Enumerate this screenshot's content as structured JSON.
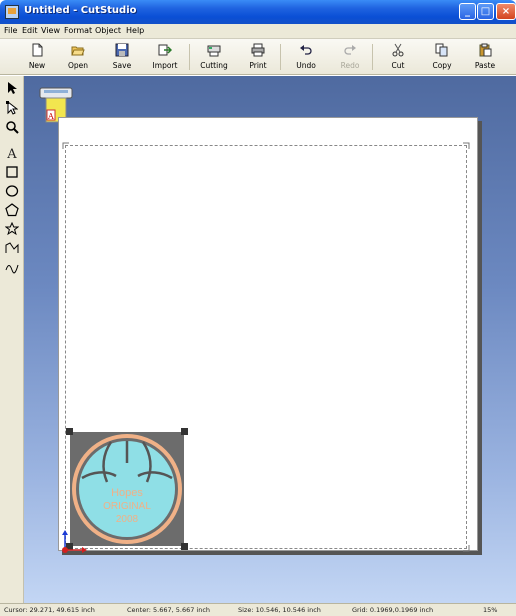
{
  "window": {
    "title": "Untitled - CutStudio"
  },
  "menu": [
    "File",
    "Edit",
    "View",
    "Format",
    "Object",
    "Help"
  ],
  "toolbar": [
    {
      "label": "New",
      "icon": "new-document-icon",
      "enabled": true
    },
    {
      "label": "Open",
      "icon": "open-folder-icon",
      "enabled": true
    },
    {
      "label": "Save",
      "icon": "save-disk-icon",
      "enabled": true
    },
    {
      "label": "Import",
      "icon": "import-icon",
      "enabled": true
    },
    {
      "label": "Cutting",
      "icon": "cutting-plotter-icon",
      "enabled": true
    },
    {
      "label": "Print",
      "icon": "printer-icon",
      "enabled": true
    },
    {
      "label": "Undo",
      "icon": "undo-icon",
      "enabled": true
    },
    {
      "label": "Redo",
      "icon": "redo-icon",
      "enabled": false
    },
    {
      "label": "Cut",
      "icon": "scissors-icon",
      "enabled": true
    },
    {
      "label": "Copy",
      "icon": "copy-icon",
      "enabled": true
    },
    {
      "label": "Paste",
      "icon": "paste-icon",
      "enabled": true
    }
  ],
  "tools": [
    "select-arrow-icon",
    "node-edit-icon",
    "zoom-icon",
    "text-tool-icon",
    "rectangle-icon",
    "ellipse-icon",
    "polygon-icon",
    "star-icon",
    "polyline-icon",
    "freehand-curve-icon"
  ],
  "tool_text": {
    "text": "A"
  },
  "printer_label": "A",
  "logo": {
    "line1": "Hopes",
    "line2": "ORIGINAL",
    "line3": "2008",
    "fill": "#8fdfe6",
    "ring": "#f0b187",
    "bg": "#6c6c6c"
  },
  "status": {
    "cursor": "Cursor: 29.271, 49.615 inch",
    "center": "Center: 5.667, 5.667 inch",
    "size": "Size: 10.546, 10.546 inch",
    "grid": "Grid: 0.1969,0.1969 inch",
    "zoom": "15%"
  },
  "colors": {
    "titlebar": "#0a4fd6",
    "workspace_top": "#4f6aa0",
    "workspace_bottom": "#c3d6f4",
    "chrome": "#ece9d8"
  }
}
